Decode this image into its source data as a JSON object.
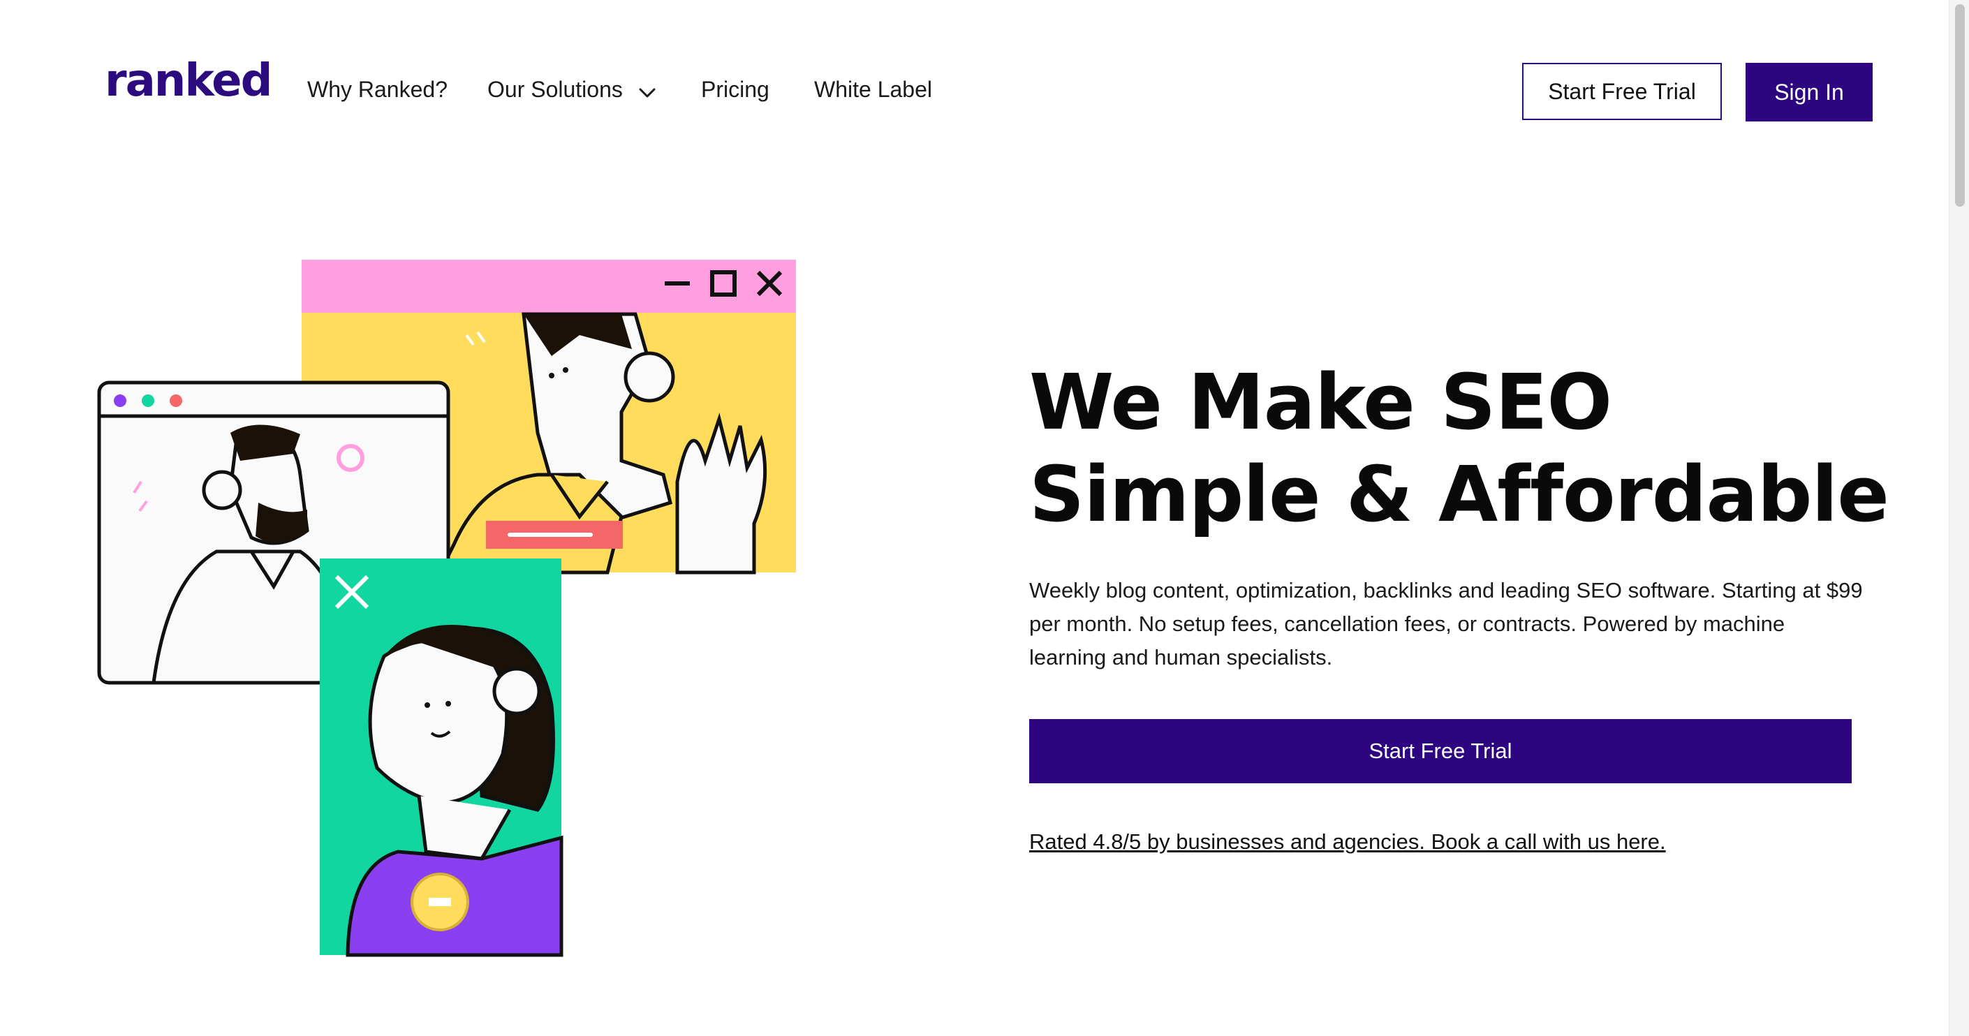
{
  "header": {
    "logo_text": "ranked",
    "nav": [
      {
        "label": "Why Ranked?"
      },
      {
        "label": "Our Solutions",
        "icon": "chevron-down-icon"
      },
      {
        "label": "Pricing"
      },
      {
        "label": "White Label"
      }
    ],
    "start_trial_label": "Start Free Trial",
    "sign_in_label": "Sign In"
  },
  "hero": {
    "title": "We Make SEO Simple & Affordable",
    "description": "Weekly blog content, optimization, backlinks and leading SEO software. Starting at $99 per month. No setup fees, cancellation fees, or contracts. Powered by machine learning and human specialists.",
    "cta_label": "Start Free Trial",
    "rating_link": "Rated 4.8/5 by businesses and agencies. Book a call with us here."
  },
  "colors": {
    "brand": "#2e0580",
    "pink": "#ff9fdf",
    "yellow": "#ffdc5c",
    "green": "#12d6a0",
    "purple": "#8a3ff0",
    "red": "#f46667"
  },
  "illustration": {
    "name": "video-call-illustration",
    "icons": [
      "minimize-icon",
      "maximize-icon",
      "close-icon",
      "window-dots-icon"
    ]
  }
}
